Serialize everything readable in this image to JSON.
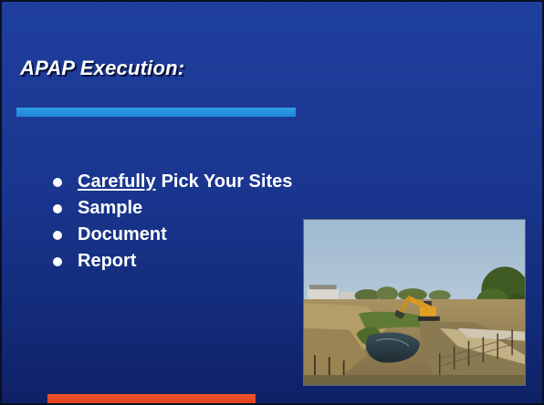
{
  "slide": {
    "title": "APAP Execution:",
    "bullets": [
      {
        "emphasis": "Carefully",
        "text": "Pick Your Sites"
      },
      {
        "emphasis": "",
        "text": "Sample"
      },
      {
        "emphasis": "",
        "text": "Document"
      },
      {
        "emphasis": "",
        "text": "Report"
      }
    ],
    "photo": {
      "subject": "excavator-at-drainage-ditch"
    }
  },
  "colors": {
    "background": "#1a3690",
    "title_rule": "#2196e0",
    "accent_bar": "#e8431f",
    "text": "#ffffff"
  }
}
